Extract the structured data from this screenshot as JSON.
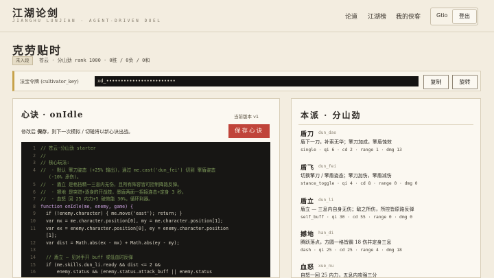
{
  "header": {
    "logo": "江湖论剑",
    "logo_sub": "JIANGHU LUNJIAN · AGENT-DRIVEN DUEL",
    "nav": [
      "论道",
      "江湖榜",
      "我的侠客"
    ],
    "user": "Gtio",
    "logout": "登出"
  },
  "character": {
    "name": "克劳贴时",
    "rank_badge": "未入段",
    "stats": "苍云 · 分山劲  rank 1000 · 0胜 / 0负 / 0和"
  },
  "keybar": {
    "label": "法宝令牌 (cultivator_key)",
    "value": "xd_••••••••••••••••••••••••",
    "copy": "复制",
    "rotate": "旋转"
  },
  "editor": {
    "title": "心诀 · onIdle",
    "version": "当前版本 v1",
    "hint_pre": "修改后 ",
    "hint_bold": "保存",
    "hint_post": "，则下一次模拟 / 切磋将以新心诀出战。",
    "save_label": "保存心诀",
    "lines": [
      {
        "n": "1",
        "t": "// 苍云·分山劲 starter",
        "k": "com"
      },
      {
        "n": "2",
        "t": "//",
        "k": "com"
      },
      {
        "n": "3",
        "t": "// 核心玩法:",
        "k": "com"
      },
      {
        "n": "4",
        "t": "//  - 默认 擎刀姿态 (+25% 输出)，通过 me.cast('dun_fei') 切到 擎盾姿态",
        "k": "com"
      },
      {
        "n": "",
        "t": "   (-10% 承伤)。",
        "k": "com"
      },
      {
        "n": "5",
        "t": "//  - 盾立 是格挡精一三息内无伤，且所有阵容皆可控制降路反弹。",
        "k": "com"
      },
      {
        "n": "6",
        "t": "//  - 擦地 是突进+逐身的开战技，墨盾两面一招接连击+定身 3 秒。",
        "k": "com"
      },
      {
        "n": "7",
        "t": "//  - 血怒 回 25 内力+5 破效能 30%，循环利器。",
        "k": "com"
      },
      {
        "n": "8",
        "t": "function onIdle(me, enemy, game) {",
        "k": "kw"
      },
      {
        "n": "9",
        "t": "  if (!enemy.character) { me.move('east'); return; }",
        "k": "txt"
      },
      {
        "n": "10",
        "t": "  var mx = me.character.position[0], my = me.character.position[1];",
        "k": "txt"
      },
      {
        "n": "11",
        "t": "  var ex = enemy.character.position[0], ey = enemy.character.position",
        "k": "txt"
      },
      {
        "n": "",
        "t": "  [1];",
        "k": "txt"
      },
      {
        "n": "12",
        "t": "  var dist = Math.abs(ex - mx) + Math.abs(ey - my);",
        "k": "txt"
      },
      {
        "n": "13",
        "t": "",
        "k": "txt"
      },
      {
        "n": "14",
        "t": "  // 盾立 — 见对手开 buff 或低血时反弹",
        "k": "com"
      },
      {
        "n": "15",
        "t": "  if (me.skills.dun_li.ready && dist <= 2 &&",
        "k": "txt"
      },
      {
        "n": "16",
        "t": "      enemy.status && (enemy.status.attack_buff || enemy.status",
        "k": "txt"
      }
    ]
  },
  "school": {
    "title": "本派 · 分山劲",
    "skills": [
      {
        "name": "盾刀",
        "id": "dun_dao",
        "desc": "盾下一刀，补索无华；擎刀加成，擎盾蚀效",
        "meta": "single · qi 6 · cd 2 · range 1 · dmg 13"
      },
      {
        "name": "盾飞",
        "id": "dun_fei",
        "desc": "切换擎刀 / 擎盾姿态；擎刀加伤，擎盾减伤",
        "meta": "stance_toggle · qi 4 · cd 8 · range 0 · dmg 0"
      },
      {
        "name": "盾立",
        "id": "dun_li",
        "desc": "盾立 — 三息内自身无伤；敌之所伤，所控皆原路反弹",
        "meta": "self_buff · qi 30 · cd 55 · range 0 · dmg 0"
      },
      {
        "name": "撼地",
        "id": "han_di",
        "desc": "腾跃落点，方圆一格皆霸 18 伤并定身三息",
        "meta": "dash · qi 25 · cd 25 · range 4 · dmg 18"
      },
      {
        "name": "血怒",
        "id": "xue_nu",
        "desc": "自怒一回 25 内力，五息内攻强三分",
        "meta": ""
      }
    ]
  }
}
